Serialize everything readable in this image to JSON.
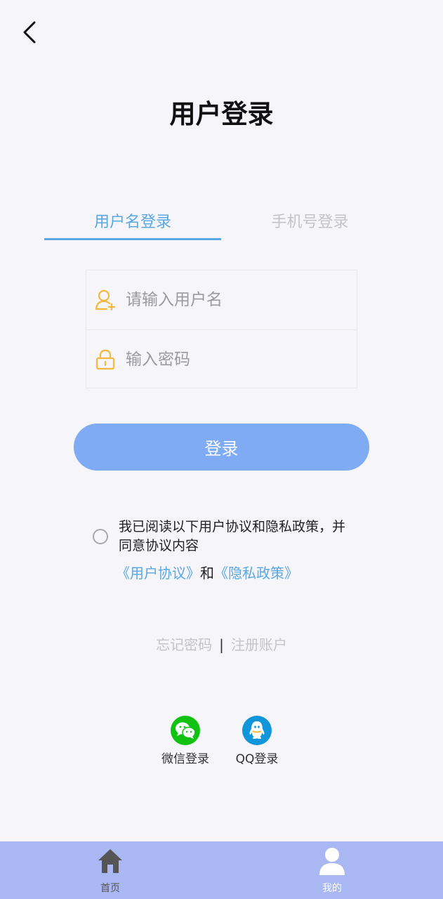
{
  "header": {
    "title": "用户登录"
  },
  "tabs": [
    {
      "label": "用户名登录",
      "active": true
    },
    {
      "label": "手机号登录",
      "active": false
    }
  ],
  "form": {
    "username_placeholder": "请输入用户名",
    "password_placeholder": "输入密码"
  },
  "login_button": "登录",
  "agreement": {
    "text": "我已阅读以下用户协议和隐私政策，并同意协议内容",
    "user_agreement": "《用户协议》",
    "and": "和",
    "privacy_policy": "《隐私政策》",
    "checked": false
  },
  "aux_links": {
    "forgot": "忘记密码",
    "separator": "|",
    "register": "注册账户"
  },
  "social": [
    {
      "label": "微信登录",
      "icon": "wechat-icon",
      "color": "#12c212"
    },
    {
      "label": "QQ登录",
      "icon": "qq-icon",
      "color": "#1296db"
    }
  ],
  "tabbar": [
    {
      "label": "首页",
      "icon": "home-icon"
    },
    {
      "label": "我的",
      "icon": "user-icon",
      "active": true
    }
  ],
  "colors": {
    "accent": "#5aa7e3",
    "button": "#7eabf3",
    "tabbar": "#a9b8f3",
    "field_icon": "#f5b83d"
  }
}
